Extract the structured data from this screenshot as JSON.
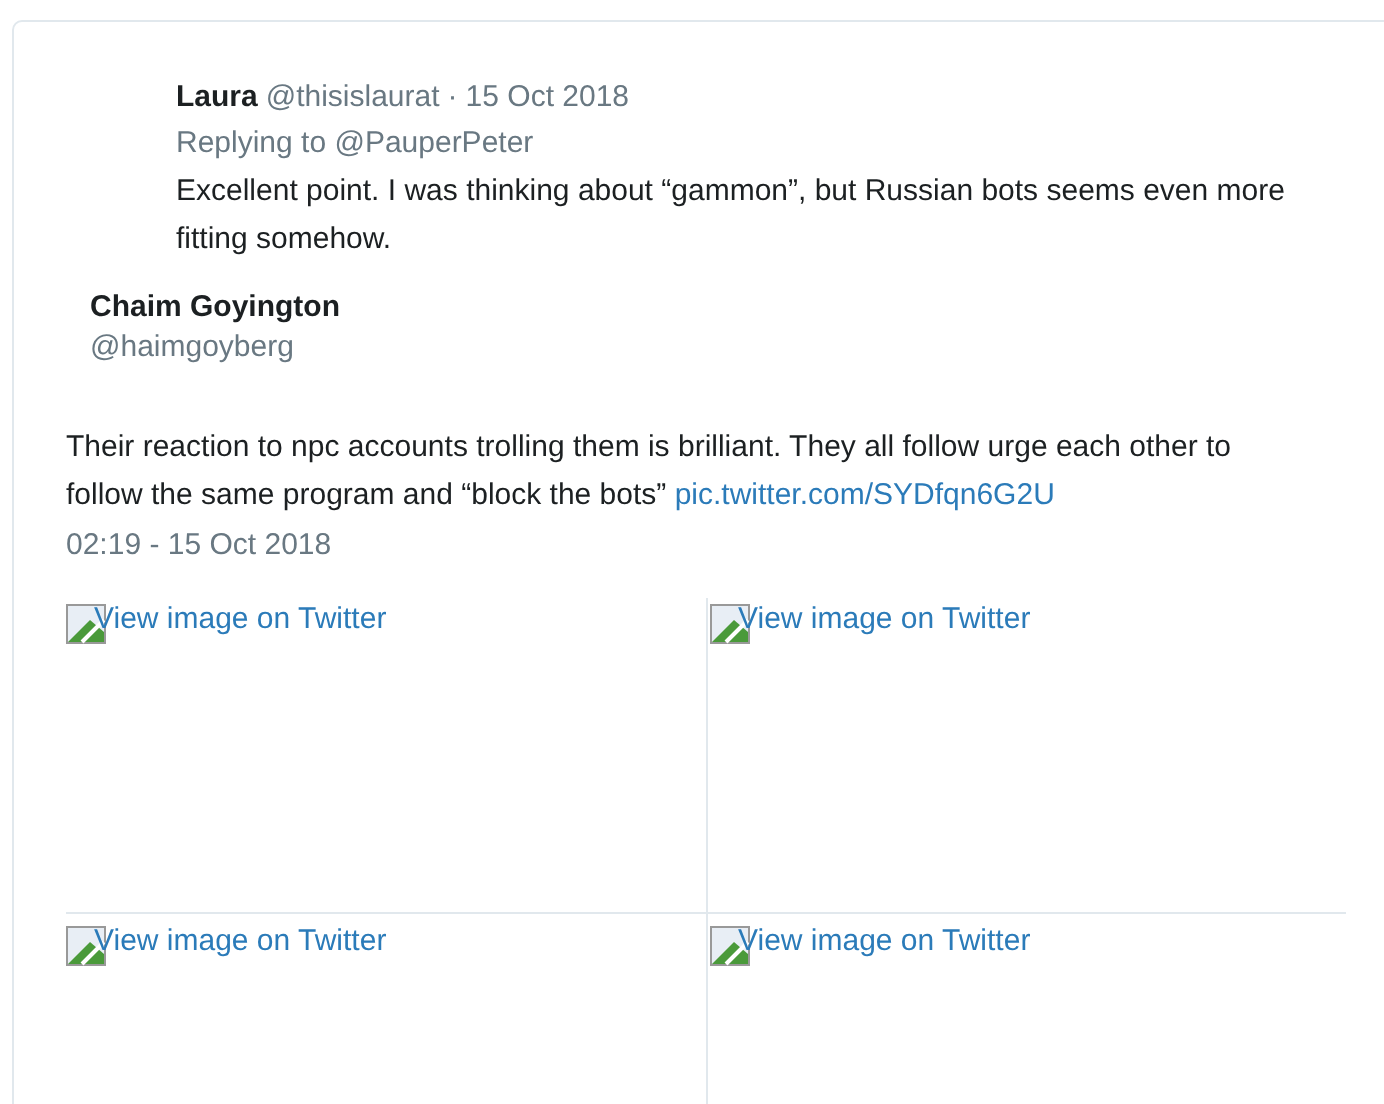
{
  "quoted_tweet": {
    "name": "Laura",
    "handle": "@thisislaurat",
    "separator": "·",
    "date": "15 Oct 2018",
    "replying_to": "Replying to @PauperPeter",
    "text": "Excellent point. I was thinking about “gammon”, but Russian bots seems even more fitting somehow."
  },
  "author": {
    "name": "Chaim Goyington",
    "handle": "@haimgoyberg"
  },
  "tweet": {
    "text": "Their reaction to npc accounts trolling them is brilliant. They all follow urge each other to follow the same program and “block the bots”",
    "link": "pic.twitter.com/SYDfqn6G2U",
    "timestamp": "02:19 - 15 Oct 2018"
  },
  "images": [
    {
      "alt": "View image on Twitter"
    },
    {
      "alt": "View image on Twitter"
    },
    {
      "alt": "View image on Twitter"
    },
    {
      "alt": "View image on Twitter"
    }
  ]
}
